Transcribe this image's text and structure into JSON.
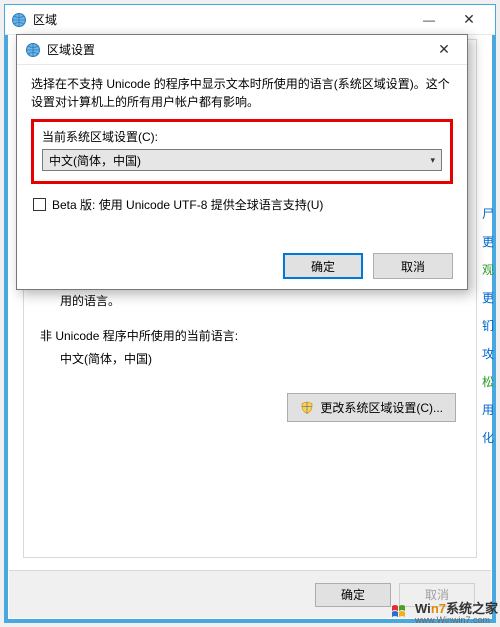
{
  "parent": {
    "title": "区域",
    "section_hint": "用的语言。",
    "nonuni_label": "非 Unicode 程序中所使用的当前语言:",
    "nonuni_value": "中文(简体，中国)",
    "change_locale_btn": "更改系统区域设置(C)...",
    "ok": "确定",
    "cancel": "取消"
  },
  "modal": {
    "title": "区域设置",
    "description": "选择在不支持 Unicode 的程序中显示文本时所使用的语言(系统区域设置)。这个设置对计算机上的所有用户帐户都有影响。",
    "current_locale_label": "当前系统区域设置(C):",
    "combo_value": "中文(简体，中国)",
    "beta_checkbox": "Beta 版: 使用 Unicode UTF-8 提供全球语言支持(U)",
    "ok": "确定",
    "cancel": "取消"
  },
  "right_links": [
    "尸",
    "更",
    "观",
    "更",
    "钔",
    "攻",
    "松",
    "用",
    "化"
  ],
  "watermark": {
    "brand_plain": "Wi",
    "brand_accent": "n7",
    "brand_suffix": "系统之家",
    "site": "www.Winwin7.com"
  }
}
